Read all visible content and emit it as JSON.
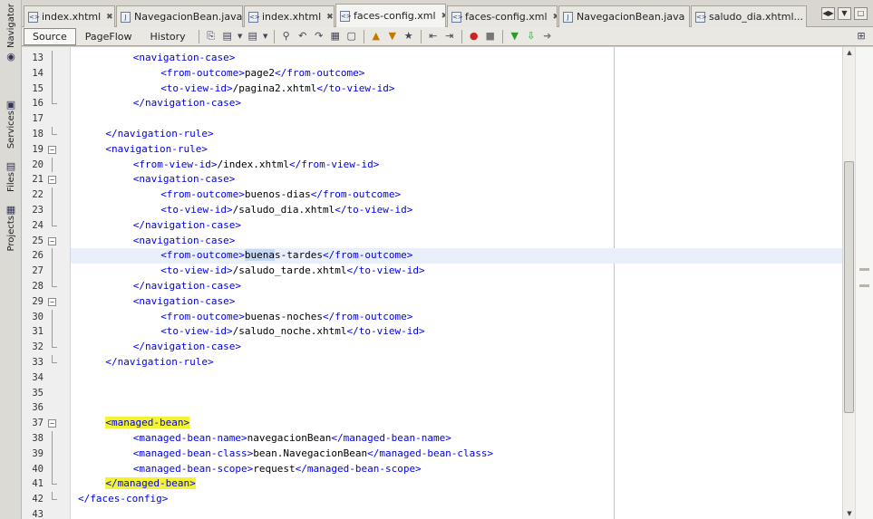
{
  "side_panel": {
    "navigator": "Navigator",
    "services": "Services",
    "files": "Files",
    "projects": "Projects"
  },
  "tabs": [
    {
      "label": "index.xhtml",
      "icon": "xhtml-file-icon",
      "active": false
    },
    {
      "label": "NavegacionBean.java",
      "icon": "java-file-icon",
      "active": false
    },
    {
      "label": "index.xhtml",
      "icon": "xhtml-file-icon",
      "active": false
    },
    {
      "label": "faces-config.xml",
      "icon": "xml-file-icon",
      "active": true
    },
    {
      "label": "faces-config.xml",
      "icon": "xml-file-icon",
      "active": false
    },
    {
      "label": "NavegacionBean.java",
      "icon": "java-file-icon",
      "active": false
    },
    {
      "label": "saludo_dia.xhtml...",
      "icon": "xhtml-file-icon",
      "active": false
    }
  ],
  "toolbar": {
    "source": "Source",
    "pageflow": "PageFlow",
    "history": "History"
  },
  "editor": {
    "current_line": 26,
    "lines": [
      {
        "n": "13",
        "indent": 4,
        "parts": [
          [
            "tag",
            "<navigation-case>"
          ]
        ]
      },
      {
        "n": "14",
        "indent": 6,
        "parts": [
          [
            "tag",
            "<from-outcome>"
          ],
          [
            "content",
            "page2"
          ],
          [
            "tag",
            "</from-outcome>"
          ]
        ]
      },
      {
        "n": "15",
        "indent": 6,
        "parts": [
          [
            "tag",
            "<to-view-id>"
          ],
          [
            "content",
            "/pagina2.xhtml"
          ],
          [
            "tag",
            "</to-view-id>"
          ]
        ]
      },
      {
        "n": "16",
        "indent": 4,
        "parts": [
          [
            "tag",
            "</navigation-case>"
          ]
        ]
      },
      {
        "n": "17",
        "indent": 0,
        "parts": []
      },
      {
        "n": "18",
        "indent": 2,
        "parts": [
          [
            "tag",
            "</navigation-rule>"
          ]
        ]
      },
      {
        "n": "19",
        "indent": 2,
        "parts": [
          [
            "tag",
            "<navigation-rule>"
          ]
        ]
      },
      {
        "n": "20",
        "indent": 4,
        "parts": [
          [
            "tag",
            "<from-view-id>"
          ],
          [
            "content",
            "/index.xhtml"
          ],
          [
            "tag",
            "</from-view-id>"
          ]
        ]
      },
      {
        "n": "21",
        "indent": 4,
        "parts": [
          [
            "tag",
            "<navigation-case>"
          ]
        ]
      },
      {
        "n": "22",
        "indent": 6,
        "parts": [
          [
            "tag",
            "<from-outcome>"
          ],
          [
            "content",
            "buenos-dias"
          ],
          [
            "tag",
            "</from-outcome>"
          ]
        ]
      },
      {
        "n": "23",
        "indent": 6,
        "parts": [
          [
            "tag",
            "<to-view-id>"
          ],
          [
            "content",
            "/saludo_dia.xhtml"
          ],
          [
            "tag",
            "</to-view-id>"
          ]
        ]
      },
      {
        "n": "24",
        "indent": 4,
        "parts": [
          [
            "tag",
            "</navigation-case>"
          ]
        ]
      },
      {
        "n": "25",
        "indent": 4,
        "parts": [
          [
            "tag",
            "<navigation-case>"
          ]
        ]
      },
      {
        "n": "26",
        "indent": 6,
        "parts": [
          [
            "tag",
            "<from-outcome>"
          ],
          [
            "hl",
            "buena"
          ],
          [
            "content",
            "s-tardes"
          ],
          [
            "tag",
            "</from-outcome>"
          ]
        ]
      },
      {
        "n": "27",
        "indent": 6,
        "parts": [
          [
            "tag",
            "<to-view-id>"
          ],
          [
            "content",
            "/saludo_tarde.xhtml"
          ],
          [
            "tag",
            "</to-view-id>"
          ]
        ]
      },
      {
        "n": "28",
        "indent": 4,
        "parts": [
          [
            "tag",
            "</navigation-case>"
          ]
        ]
      },
      {
        "n": "29",
        "indent": 4,
        "parts": [
          [
            "tag",
            "<navigation-case>"
          ]
        ]
      },
      {
        "n": "30",
        "indent": 6,
        "parts": [
          [
            "tag",
            "<from-outcome>"
          ],
          [
            "content",
            "buenas-noches"
          ],
          [
            "tag",
            "</from-outcome>"
          ]
        ]
      },
      {
        "n": "31",
        "indent": 6,
        "parts": [
          [
            "tag",
            "<to-view-id>"
          ],
          [
            "content",
            "/saludo_noche.xhtml"
          ],
          [
            "tag",
            "</to-view-id>"
          ]
        ]
      },
      {
        "n": "32",
        "indent": 4,
        "parts": [
          [
            "tag",
            "</navigation-case>"
          ]
        ]
      },
      {
        "n": "33",
        "indent": 2,
        "parts": [
          [
            "tag",
            "</navigation-rule>"
          ]
        ]
      },
      {
        "n": "34",
        "indent": 0,
        "parts": []
      },
      {
        "n": "35",
        "indent": 0,
        "parts": []
      },
      {
        "n": "36",
        "indent": 0,
        "parts": []
      },
      {
        "n": "37",
        "indent": 2,
        "parts": [
          [
            "tag yellow",
            "<managed-bean>"
          ]
        ]
      },
      {
        "n": "38",
        "indent": 4,
        "parts": [
          [
            "tag",
            "<managed-bean-name>"
          ],
          [
            "content",
            "navegacionBean"
          ],
          [
            "tag",
            "</managed-bean-name>"
          ]
        ]
      },
      {
        "n": "39",
        "indent": 4,
        "parts": [
          [
            "tag",
            "<managed-bean-class>"
          ],
          [
            "content",
            "bean.NavegacionBean"
          ],
          [
            "tag",
            "</managed-bean-class>"
          ]
        ]
      },
      {
        "n": "40",
        "indent": 4,
        "parts": [
          [
            "tag",
            "<managed-bean-scope>"
          ],
          [
            "content",
            "request"
          ],
          [
            "tag",
            "</managed-bean-scope>"
          ]
        ]
      },
      {
        "n": "41",
        "indent": 2,
        "parts": [
          [
            "tag yellow",
            "</managed-bean>"
          ]
        ]
      },
      {
        "n": "42",
        "indent": 0,
        "parts": [
          [
            "tag",
            "</faces-config>"
          ]
        ]
      },
      {
        "n": "43",
        "indent": 0,
        "parts": []
      }
    ],
    "folds": {
      "13": "bar",
      "14": "bar",
      "15": "bar",
      "16": "end",
      "17": "none",
      "18": "end",
      "19": "open",
      "20": "bar",
      "21": "open",
      "22": "bar",
      "23": "bar",
      "24": "end",
      "25": "open",
      "26": "bar",
      "27": "bar",
      "28": "end",
      "29": "open",
      "30": "bar",
      "31": "bar",
      "32": "end",
      "33": "end",
      "34": "none",
      "35": "none",
      "36": "none",
      "37": "open",
      "38": "bar",
      "39": "bar",
      "40": "bar",
      "41": "end",
      "42": "end",
      "43": "none"
    }
  }
}
